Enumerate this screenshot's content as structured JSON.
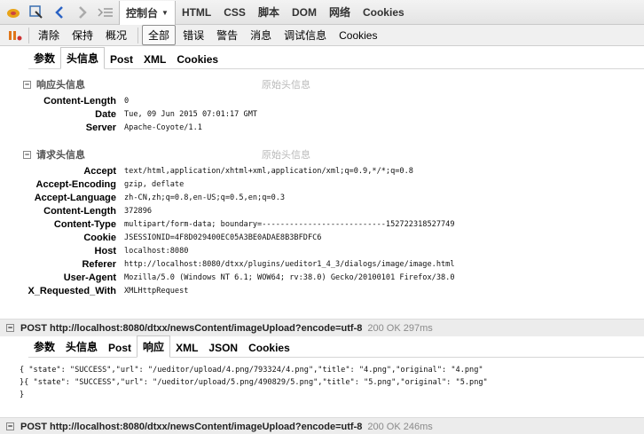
{
  "toolbar": {
    "panel_tabs": [
      "控制台",
      "HTML",
      "CSS",
      "脚本",
      "DOM",
      "网络",
      "Cookies"
    ],
    "console_buttons": [
      "清除",
      "保持",
      "概况"
    ],
    "filters": [
      "全部",
      "错误",
      "警告",
      "消息",
      "调试信息",
      "Cookies"
    ]
  },
  "top_request": {
    "tabs": [
      "参数",
      "头信息",
      "Post",
      "XML",
      "Cookies"
    ],
    "response_headers": {
      "title": "响应头信息",
      "raw": "原始头信息",
      "rows": [
        {
          "name": "Content-Length",
          "value": "0"
        },
        {
          "name": "Date",
          "value": "Tue, 09 Jun 2015 07:01:17 GMT"
        },
        {
          "name": "Server",
          "value": "Apache-Coyote/1.1"
        }
      ]
    },
    "request_headers": {
      "title": "请求头信息",
      "raw": "原始头信息",
      "rows": [
        {
          "name": "Accept",
          "value": "text/html,application/xhtml+xml,application/xml;q=0.9,*/*;q=0.8"
        },
        {
          "name": "Accept-Encoding",
          "value": "gzip, deflate"
        },
        {
          "name": "Accept-Language",
          "value": "zh-CN,zh;q=0.8,en-US;q=0.5,en;q=0.3"
        },
        {
          "name": "Content-Length",
          "value": "372896"
        },
        {
          "name": "Content-Type",
          "value": "multipart/form-data; boundary=---------------------------152722318527749"
        },
        {
          "name": "Cookie",
          "value": "JSESSIONID=4F8D029400EC05A3BE0ADAE8B3BFDFC6"
        },
        {
          "name": "Host",
          "value": "localhost:8080"
        },
        {
          "name": "Referer",
          "value": "http://localhost:8080/dtxx/plugins/ueditor1_4_3/dialogs/image/image.html"
        },
        {
          "name": "User-Agent",
          "value": "Mozilla/5.0 (Windows NT 6.1; WOW64; rv:38.0) Gecko/20100101 Firefox/38.0"
        },
        {
          "name": "X_Requested_With",
          "value": "XMLHttpRequest"
        }
      ]
    }
  },
  "request1": {
    "method_url": "POST http://localhost:8080/dtxx/newsContent/imageUpload?encode=utf-8",
    "status": "200 OK 297ms",
    "tabs": [
      "参数",
      "头信息",
      "Post",
      "响应",
      "XML",
      "JSON",
      "Cookies"
    ],
    "response_lines": [
      "{ \"state\": \"SUCCESS\",\"url\": \"/ueditor/upload/4.png/793324/4.png\",\"title\": \"4.png\",\"original\": \"4.png\"",
      "}{ \"state\": \"SUCCESS\",\"url\": \"/ueditor/upload/5.png/490829/5.png\",\"title\": \"5.png\",\"original\": \"5.png\"",
      "}"
    ]
  },
  "request2": {
    "method_url": "POST http://localhost:8080/dtxx/newsContent/imageUpload?encode=utf-8",
    "status": "200 OK 246ms"
  }
}
